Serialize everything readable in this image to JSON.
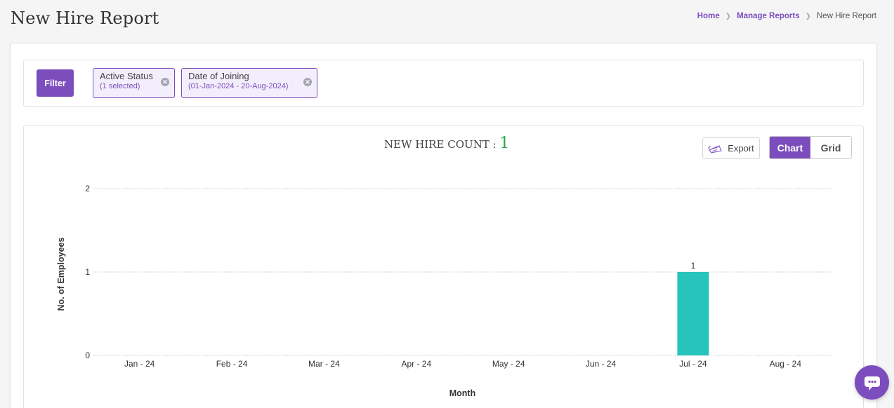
{
  "page": {
    "title": "New Hire Report"
  },
  "breadcrumb": {
    "home": "Home",
    "manage_reports": "Manage Reports",
    "current": "New Hire Report"
  },
  "filters": {
    "button_label": "Filter",
    "chips": [
      {
        "title": "Active Status",
        "sub": "(1 selected)"
      },
      {
        "title": "Date of Joining",
        "sub": "(01-Jan-2024 - 20-Aug-2024)"
      }
    ]
  },
  "summary": {
    "label": "NEW HIRE COUNT : ",
    "value": "1"
  },
  "toolbar": {
    "export_label": "Export",
    "chart_label": "Chart",
    "grid_label": "Grid"
  },
  "icons": {
    "export": "export-icon",
    "chip_remove": "close-circle-icon",
    "chat": "chat-icon",
    "breadcrumb_sep": "chevron-right-icon"
  },
  "colors": {
    "accent": "#7c4dbc",
    "bar": "#26c4ba",
    "count": "#2ea44f"
  },
  "chart_data": {
    "type": "bar",
    "categories": [
      "Jan - 24",
      "Feb - 24",
      "Mar - 24",
      "Apr - 24",
      "May - 24",
      "Jun - 24",
      "Jul - 24",
      "Aug - 24"
    ],
    "values": [
      0,
      0,
      0,
      0,
      0,
      0,
      1,
      0
    ],
    "data_labels": [
      "",
      "",
      "",
      "",
      "",
      "",
      "1",
      ""
    ],
    "xlabel": "Month",
    "ylabel": "No. of Employees",
    "ylim": [
      0,
      2
    ],
    "yticks": [
      "0",
      "1",
      "2"
    ],
    "grid": true
  }
}
